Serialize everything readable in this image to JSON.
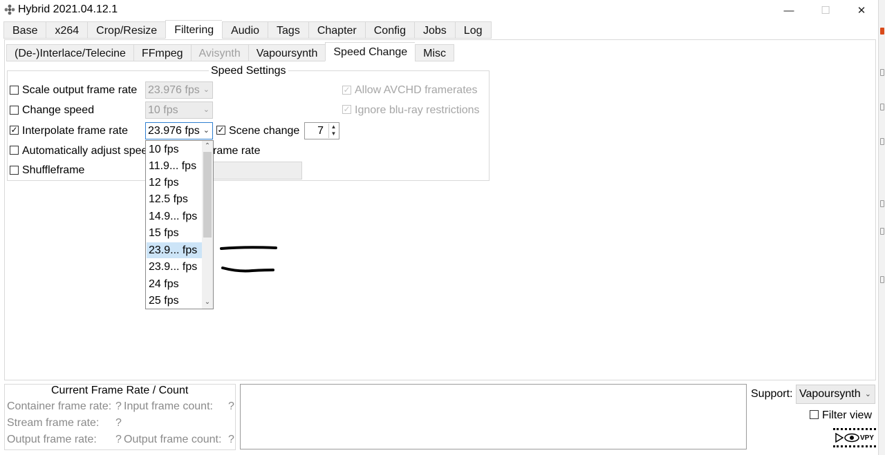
{
  "window": {
    "title": "Hybrid 2021.04.12.1",
    "minimize_glyph": "—",
    "maximize_glyph": "☐",
    "close_glyph": "✕"
  },
  "main_tabs": [
    {
      "label": "Base"
    },
    {
      "label": "x264"
    },
    {
      "label": "Crop/Resize"
    },
    {
      "label": "Filtering",
      "active": true
    },
    {
      "label": "Audio"
    },
    {
      "label": "Tags"
    },
    {
      "label": "Chapter"
    },
    {
      "label": "Config"
    },
    {
      "label": "Jobs"
    },
    {
      "label": "Log"
    }
  ],
  "sub_tabs": [
    {
      "label": "(De-)Interlace/Telecine"
    },
    {
      "label": "FFmpeg"
    },
    {
      "label": "Avisynth",
      "disabled": true
    },
    {
      "label": "Vapoursynth"
    },
    {
      "label": "Speed Change",
      "active": true
    },
    {
      "label": "Misc"
    }
  ],
  "speed_settings": {
    "title": "Speed Settings",
    "scale_output": {
      "label": "Scale output frame rate",
      "checked": false,
      "value": "23.976 fps"
    },
    "change_speed": {
      "label": "Change speed",
      "checked": false,
      "value": "10 fps"
    },
    "interpolate": {
      "label": "Interpolate frame rate",
      "checked": true,
      "value": "23.976 fps"
    },
    "scene_change": {
      "label": "Scene change",
      "checked": true,
      "value": "7"
    },
    "auto_adjust": {
      "label_left": "Automatically adjust spee",
      "label_right": "rame rate",
      "checked": false
    },
    "shuffleframe": {
      "label": "Shuffleframe",
      "checked": false
    },
    "allow_avchd": {
      "label": "Allow AVCHD framerates",
      "checked": true,
      "disabled": true
    },
    "ignore_bluray": {
      "label": "Ignore blu-ray restrictions",
      "checked": true,
      "disabled": true
    }
  },
  "dropdown": {
    "items": [
      "10 fps",
      "11.9... fps",
      "12 fps",
      "12.5 fps",
      "14.9... fps",
      "15 fps",
      "23.9... fps",
      "23.9... fps",
      "24 fps",
      "25 fps"
    ],
    "selected_index": 6,
    "up_glyph": "⌃",
    "down_glyph": "⌄"
  },
  "current_frame_rate": {
    "title": "Current Frame Rate / Count",
    "container_label": "Container frame rate:",
    "container_value": "?",
    "input_count_label": "Input frame count:",
    "input_count_value": "?",
    "stream_label": "Stream frame rate:",
    "stream_value": "?",
    "output_label": "Output frame rate:",
    "output_value": "?",
    "output_count_label": "Output frame count:",
    "output_count_value": "?"
  },
  "support": {
    "label": "Support:",
    "value": "Vapoursynth"
  },
  "filter_view": {
    "label": "Filter view",
    "checked": false
  },
  "vpy_icon": {
    "text": "VPY"
  },
  "glyphs": {
    "check": "✓",
    "combo_arrow": "⌄",
    "spin_up": "▲",
    "spin_down": "▼"
  }
}
